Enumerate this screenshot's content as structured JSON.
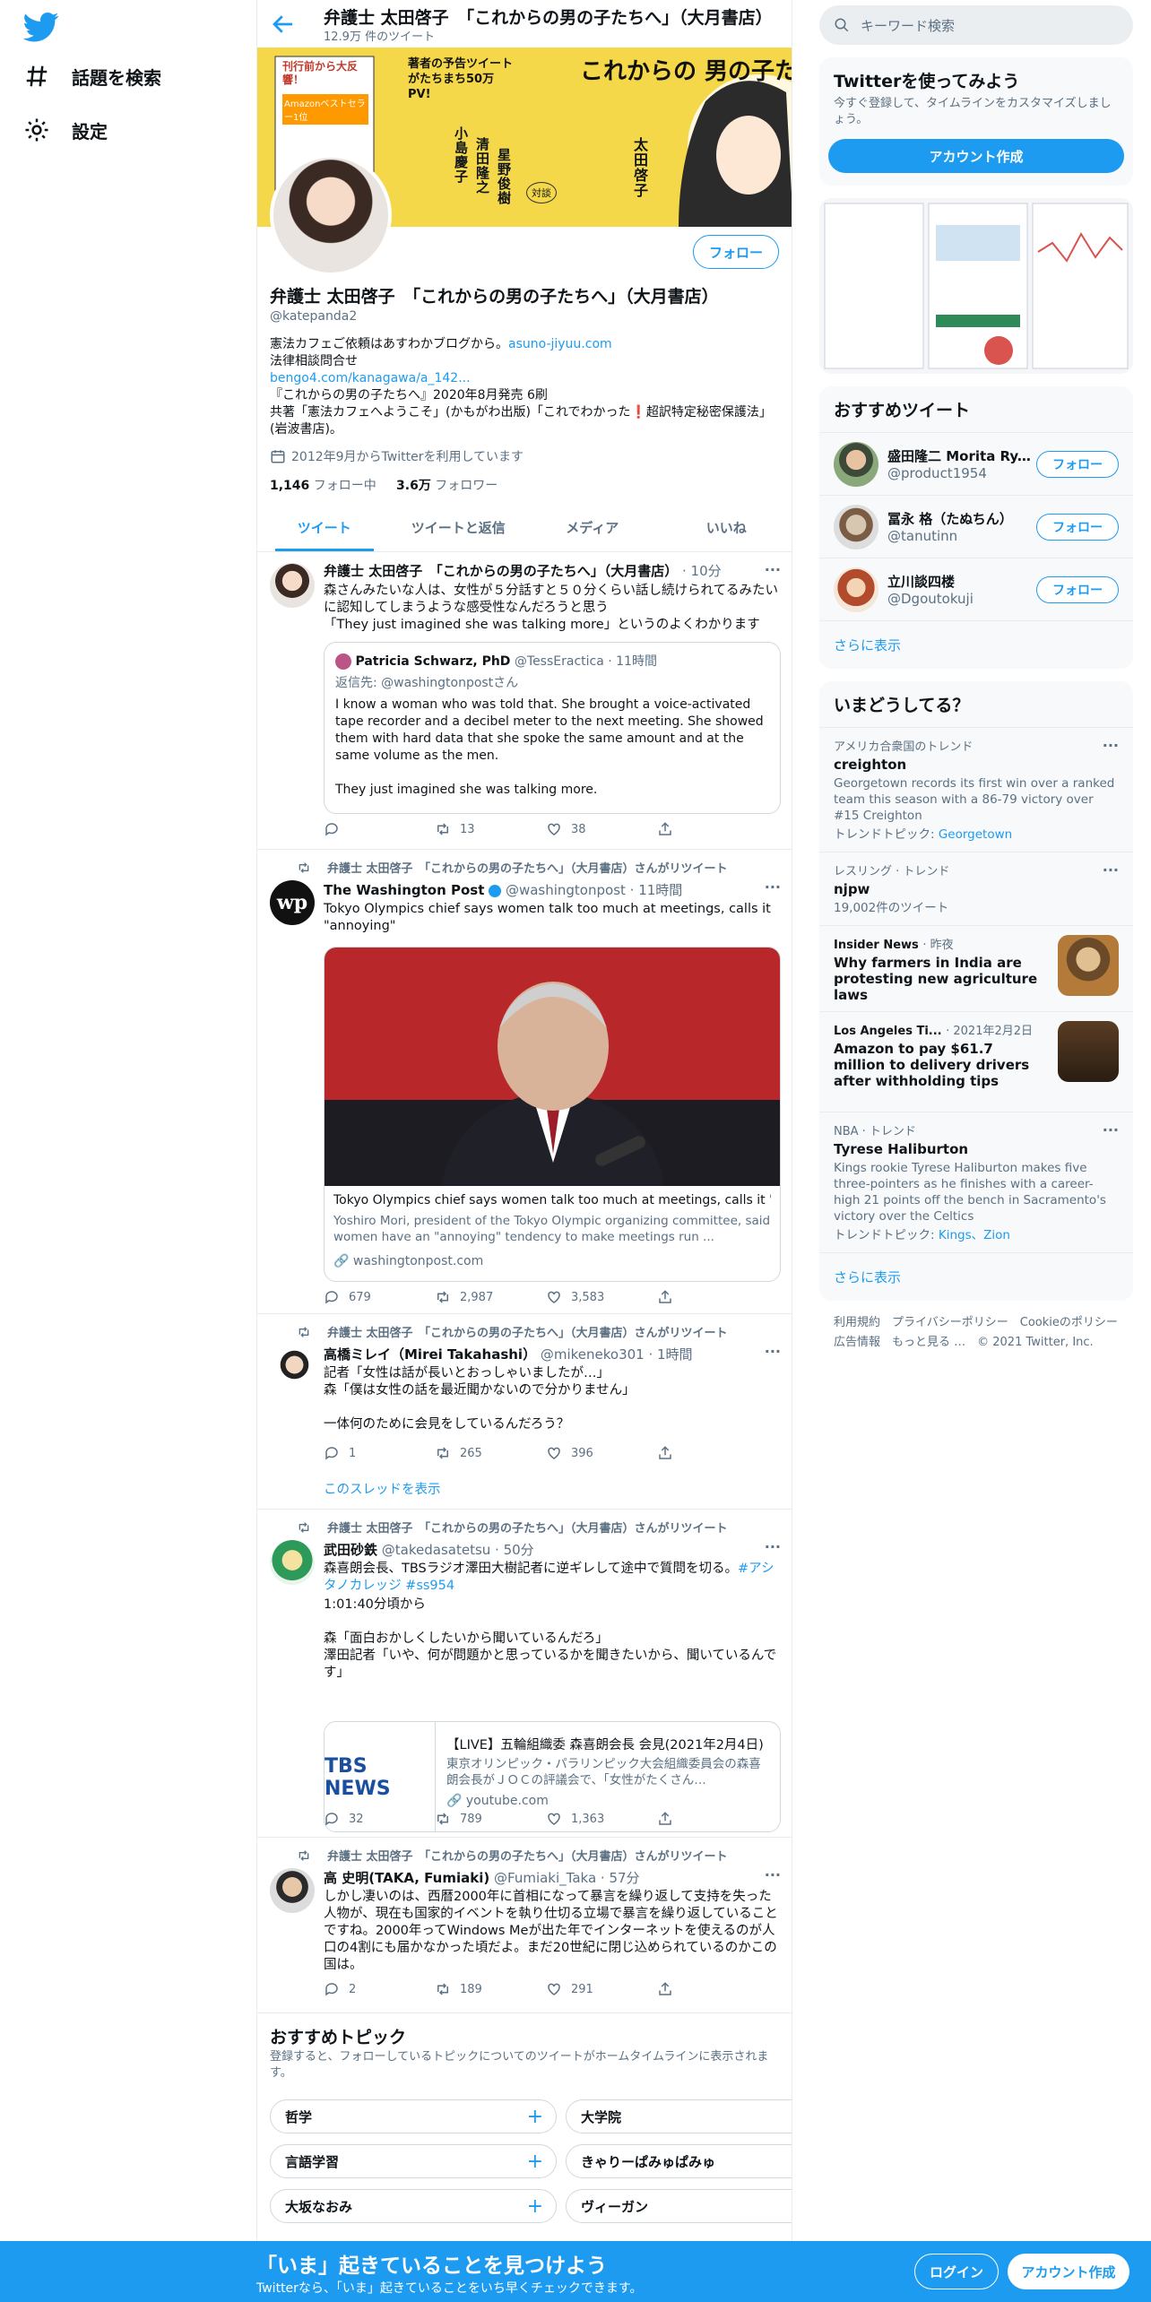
{
  "nav": {
    "explore": "話題を検索",
    "settings": "設定"
  },
  "header": {
    "title": "弁護士 太田啓子　「これからの男の子たちへ」（大月書店）",
    "tweet_count": "12.9万 件のツイート"
  },
  "banner": {
    "main_title": "これからの 男の子たちへ",
    "preorder": "刊行前から大反響！",
    "amazon": "Amazonベストセラー1位",
    "preview": "著者の予告ツイートがたちまち50万PV!",
    "speakers_label": "対談",
    "speaker1": "小島慶子",
    "speaker2": "清田隆之",
    "speaker3": "星野俊樹",
    "author": "太田啓子"
  },
  "profile": {
    "follow_label": "フォロー",
    "name": "弁護士 太田啓子　「これからの男の子たちへ」（大月書店）",
    "handle": "@katepanda2",
    "bio1": "憲法カフェご依頼はあすわかブログから。",
    "bio1_link": "asuno-jiyuu.com",
    "bio2": "法律相談問合せ",
    "bio2_link": "bengo4.com/kanagawa/a_142...",
    "bio3": "『これからの男の子たちへ』2020年8月発売 6刷",
    "bio4": "共著「憲法カフェへようこそ」(かもがわ出版)「これでわかった❗️超訳特定秘密保護法」(岩波書店)。",
    "joined": "2012年9月からTwitterを利用しています",
    "following_count": "1,146",
    "following_label": "フォロー中",
    "followers_count": "3.6万",
    "followers_label": "フォロワー"
  },
  "tabs": [
    "ツイート",
    "ツイートと返信",
    "メディア",
    "いいね"
  ],
  "tweets": [
    {
      "name": "弁護士 太田啓子　「これからの男の子たちへ」（大月書店）",
      "meta": "· 10分",
      "text": "森さんみたいな人は、女性が５分話すと５０分くらい話し続けられてるみたいに認知してしまうような感受性なんだろうと思う\n「They just imagined she was talking more」というのよくわかります",
      "quote_name": "Patricia Schwarz, PhD",
      "quote_handle": "@TessEractica · 11時間",
      "quote_reply": "返信先: @washingtonpostさん",
      "quote_text": "I know a woman who was told that. She brought a voice-activated tape recorder and a decibel meter to the next meeting. She showed them with hard data that she spoke the same amount and at the same volume as the men.\n\nThey just imagined she was talking more.",
      "reply": "",
      "retweet": "13",
      "like": "38"
    },
    {
      "rt": "弁護士 太田啓子　「これからの男の子たちへ」（大月書店）さんがリツイート",
      "name": "The Washington Post",
      "handle": "@washingtonpost · 11時間",
      "text": "Tokyo Olympics chief says women talk too much at meetings, calls it \"annoying\"",
      "card_title": "Tokyo Olympics chief says women talk too much at meetings, calls it '…",
      "card_desc": "Yoshiro Mori, president of the Tokyo Olympic organizing committee, said women have an \"annoying\" tendency to make meetings run ...",
      "card_link": "washingtonpost.com",
      "reply": "679",
      "retweet": "2,987",
      "like": "3,583"
    },
    {
      "rt": "弁護士 太田啓子　「これからの男の子たちへ」（大月書店）さんがリツイート",
      "name": "高橋ミレイ（Mirei Takahashi）",
      "handle": "@mikeneko301 · 1時間",
      "text": "記者「女性は話が長いとおっしゃいましたが…」\n森「僕は女性の話を最近聞かないので分かりません」\n\n一体何のために会見をしているんだろう？",
      "thread": "このスレッドを表示",
      "reply": "1",
      "retweet": "265",
      "like": "396"
    },
    {
      "rt": "弁護士 太田啓子　「これからの男の子たちへ」（大月書店）さんがリツイート",
      "name": "武田砂鉄",
      "handle": "@takedasatetsu · 50分",
      "text": "森喜朗会長、TBSラジオ澤田大樹記者に逆ギレして途中で質問を切る。",
      "tags": "#アシタノカレッジ #ss954",
      "text2": "1:01:40分頃から\n\n森「面白おかしくしたいから聞いているんだろ」\n澤田記者「いや、何が問題かと思っているかを聞きたいから、聞いているんです」",
      "card_logo": "TBS NEWS",
      "card_title": "【LIVE】五輪組織委 森喜朗会長 会見(2021年2月4日)",
      "card_desc": "東京オリンピック・パラリンピック大会組織委員会の森喜朗会長がＪＯＣの評議会で、「女性がたくさん…",
      "card_link": "youtube.com",
      "reply": "32",
      "retweet": "789",
      "like": "1,363"
    },
    {
      "rt": "弁護士 太田啓子　「これからの男の子たちへ」（大月書店）さんがリツイート",
      "name": "高 史明(TAKA, Fumiaki)",
      "handle": "@Fumiaki_Taka · 57分",
      "text": "しかし凄いのは、西暦2000年に首相になって暴言を繰り返して支持を失った人物が、現在も国家的イベントを執り仕切る立場で暴言を繰り返していることですね。2000年ってWindows Meが出た年でインターネットを使えるのが人口の4割にも届かなかった頃だよ。まだ20世紀に閉じ込められているのかこの国は。",
      "reply": "2",
      "retweet": "189",
      "like": "291"
    }
  ],
  "topics": {
    "title": "おすすめトピック",
    "desc": "登録すると、フォローしているトピックについてのツイートがホームタイムラインに表示されます。",
    "items": [
      "哲学",
      "大学院",
      "言語学習",
      "きゃりーぱみゅぱみゅ",
      "大坂なおみ",
      "ヴィーガン"
    ]
  },
  "right": {
    "search_placeholder": "キーワード検索",
    "signup_title": "Twitterを使ってみよう",
    "signup_desc": "今すぐ登録して、タイムラインをカスタマイズしましょう。",
    "signup_btn": "アカウント作成",
    "who_title": "おすすめツイート",
    "who": [
      {
        "name": "盛田隆二",
        "name2": "Morita Ry...",
        "handle": "@product1954"
      },
      {
        "name": "冨永 格（たぬちん）",
        "handle": "@tanutinn"
      },
      {
        "name": "立川談四楼",
        "handle": "@Dgoutokuji"
      }
    ],
    "follow_label": "フォロー",
    "show_more": "さらに表示",
    "trends_title": "いまどうしてる？",
    "trends": [
      {
        "ctx": "アメリカ合衆国のトレンド",
        "title": "creighton",
        "desc": "Georgetown records its first win over a ranked team this season with a 86-79 victory over #15 Creighton",
        "topic_label": "トレンドトピック: ",
        "topic": "Georgetown"
      },
      {
        "ctx": "レスリング · トレンド",
        "title": "njpw",
        "desc": "19,002件のツイート"
      },
      {
        "ctx": "Insider News",
        "ctx2": "· 昨夜",
        "title": "Why farmers in India are protesting new agriculture laws"
      },
      {
        "ctx": "Los Angeles Ti...",
        "ctx2": "· 2021年2月2日",
        "title": "Amazon to pay $61.7 million to delivery drivers after withholding tips"
      },
      {
        "ctx": "NBA · トレンド",
        "title": "Tyrese Haliburton",
        "desc": "Kings rookie Tyrese Haliburton makes five three-pointers as he finishes with a career-high 21 points off the bench in Sacramento's victory over the Celtics",
        "topic_label": "トレンドトピック: ",
        "topic": "Kings、Zion"
      }
    ],
    "footer1": "利用規約　プライバシーポリシー　Cookieのポリシー",
    "footer2": "広告情報　もっと見る …　© 2021 Twitter, Inc."
  },
  "bottom": {
    "title": "「いま」起きていることを見つけよう",
    "desc": "Twitterなら、「いま」起きていることをいち早くチェックできます。",
    "login": "ログイン",
    "signup": "アカウント作成"
  },
  "colors": {
    "accent": "#1d9bf0",
    "banner": "#f5d84a"
  }
}
